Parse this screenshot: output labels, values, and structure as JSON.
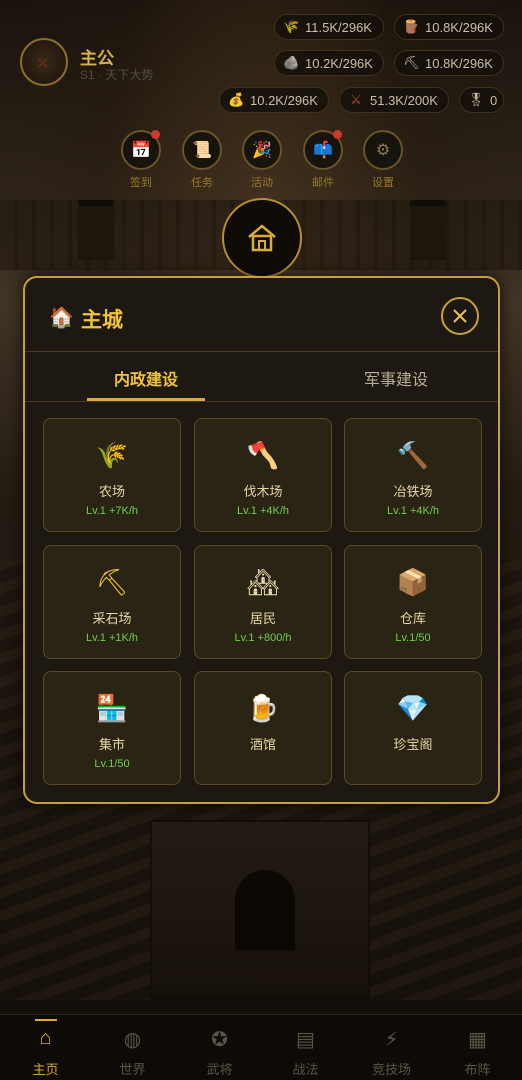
{
  "player": {
    "name": "主公",
    "subtitle": "S1 · 天下大势"
  },
  "resources": [
    {
      "icon": "grain-icon",
      "glyph": "🌾",
      "value": "11.5K/296K"
    },
    {
      "icon": "wood-icon",
      "glyph": "🪵",
      "value": "10.8K/296K"
    },
    {
      "icon": "stone-icon",
      "glyph": "🪨",
      "value": "10.2K/296K"
    },
    {
      "icon": "iron-icon",
      "glyph": "⛏",
      "value": "10.8K/296K"
    },
    {
      "icon": "gold-icon",
      "glyph": "💰",
      "value": "10.2K/296K"
    },
    {
      "icon": "troops-icon",
      "glyph": "⚔",
      "value": "51.3K/200K"
    },
    {
      "icon": "token-icon",
      "glyph": "🎖",
      "value": "0"
    }
  ],
  "menu": [
    {
      "icon": "calendar-icon",
      "glyph": "📅",
      "label": "签到",
      "badge": true
    },
    {
      "icon": "scroll-icon",
      "glyph": "📜",
      "label": "任务",
      "badge": false
    },
    {
      "icon": "party-icon",
      "glyph": "🎉",
      "label": "活动",
      "badge": false
    },
    {
      "icon": "mailbox-icon",
      "glyph": "📫",
      "label": "邮件",
      "badge": true
    },
    {
      "icon": "settings-icon",
      "glyph": "⚙",
      "label": "设置",
      "badge": false
    }
  ],
  "modal": {
    "title_icon": "🏠",
    "title": "主城",
    "tabs": [
      "内政建设",
      "军事建设"
    ],
    "active_tab": 0
  },
  "buildings": [
    {
      "icon": "wheat-icon",
      "glyph": "🌾",
      "name": "农场",
      "level": "Lv.1 +7K/h"
    },
    {
      "icon": "axe-icon",
      "glyph": "🪓",
      "name": "伐木场",
      "level": "Lv.1 +4K/h"
    },
    {
      "icon": "hammer-icon",
      "glyph": "🔨",
      "name": "冶铁场",
      "level": "Lv.1 +4K/h"
    },
    {
      "icon": "pickaxe-icon",
      "glyph": "⛏",
      "name": "采石场",
      "level": "Lv.1 +1K/h"
    },
    {
      "icon": "houses-icon",
      "glyph": "🏘",
      "name": "居民",
      "level": "Lv.1 +800/h"
    },
    {
      "icon": "box-icon",
      "glyph": "📦",
      "name": "仓库",
      "level": "Lv.1/50"
    },
    {
      "icon": "shop-icon",
      "glyph": "🏪",
      "name": "集市",
      "level": "Lv.1/50"
    },
    {
      "icon": "beer-icon",
      "glyph": "🍺",
      "name": "酒馆",
      "level": ""
    },
    {
      "icon": "gem-icon",
      "glyph": "💎",
      "name": "珍宝阁",
      "level": ""
    }
  ],
  "nav": [
    {
      "icon": "home-icon",
      "glyph": "⌂",
      "label": "主页",
      "active": true
    },
    {
      "icon": "globe-icon",
      "glyph": "◍",
      "label": "世界",
      "active": false
    },
    {
      "icon": "general-icon",
      "glyph": "✪",
      "label": "武将",
      "active": false
    },
    {
      "icon": "tactics-icon",
      "glyph": "▤",
      "label": "战法",
      "active": false
    },
    {
      "icon": "arena-icon",
      "glyph": "⚡",
      "label": "竞技场",
      "active": false
    },
    {
      "icon": "formation-icon",
      "glyph": "▦",
      "label": "布阵",
      "active": false
    }
  ],
  "colors": {
    "accent": "#d9ac37",
    "level_green": "#6fcf4a",
    "badge_red": "#d0362a"
  }
}
